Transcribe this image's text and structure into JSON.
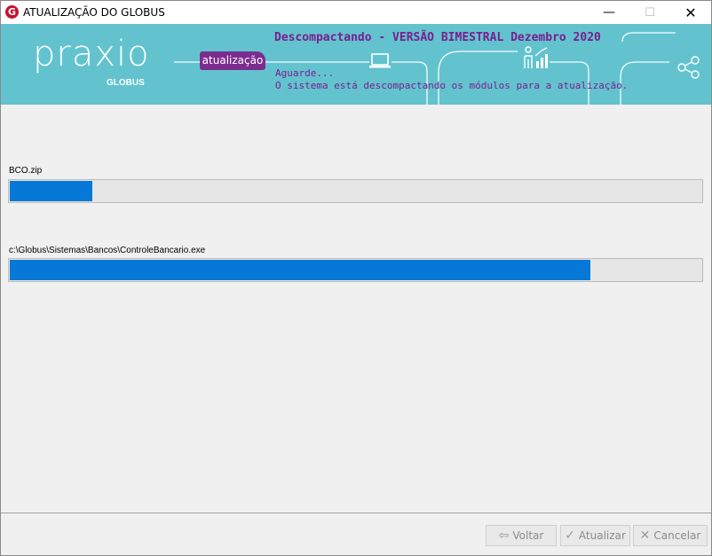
{
  "window": {
    "title": "ATUALIZAÇÃO DO GLOBUS",
    "app_icon_letter": "G",
    "controls": {
      "minimize": "—",
      "maximize": "☐",
      "close": "✕"
    }
  },
  "banner": {
    "logo": "praxio",
    "logo_sub": "GLOBUS",
    "tag": "atualização",
    "headline": "Descompactando - VERSÃO BIMESTRAL Dezembro 2020",
    "status_line1": "Aguarde...",
    "status_line2": "O sistema está descompactando os módulos para a atualização.",
    "icons": [
      "laptop-icon",
      "people-chart-icon",
      "share-icon"
    ]
  },
  "progress": [
    {
      "label": "BCO.zip",
      "fraction": 0.12
    },
    {
      "label": "c:\\Globus\\Sistemas\\Bancos\\ControleBancario.exe",
      "fraction": 0.84
    }
  ],
  "footer": {
    "back_label": "Voltar",
    "update_label": "Atualizar",
    "cancel_label": "Cancelar"
  },
  "colors": {
    "banner_bg": "#62c3cf",
    "accent_purple": "#7b2d8e",
    "progress_fill": "#0678d7"
  }
}
